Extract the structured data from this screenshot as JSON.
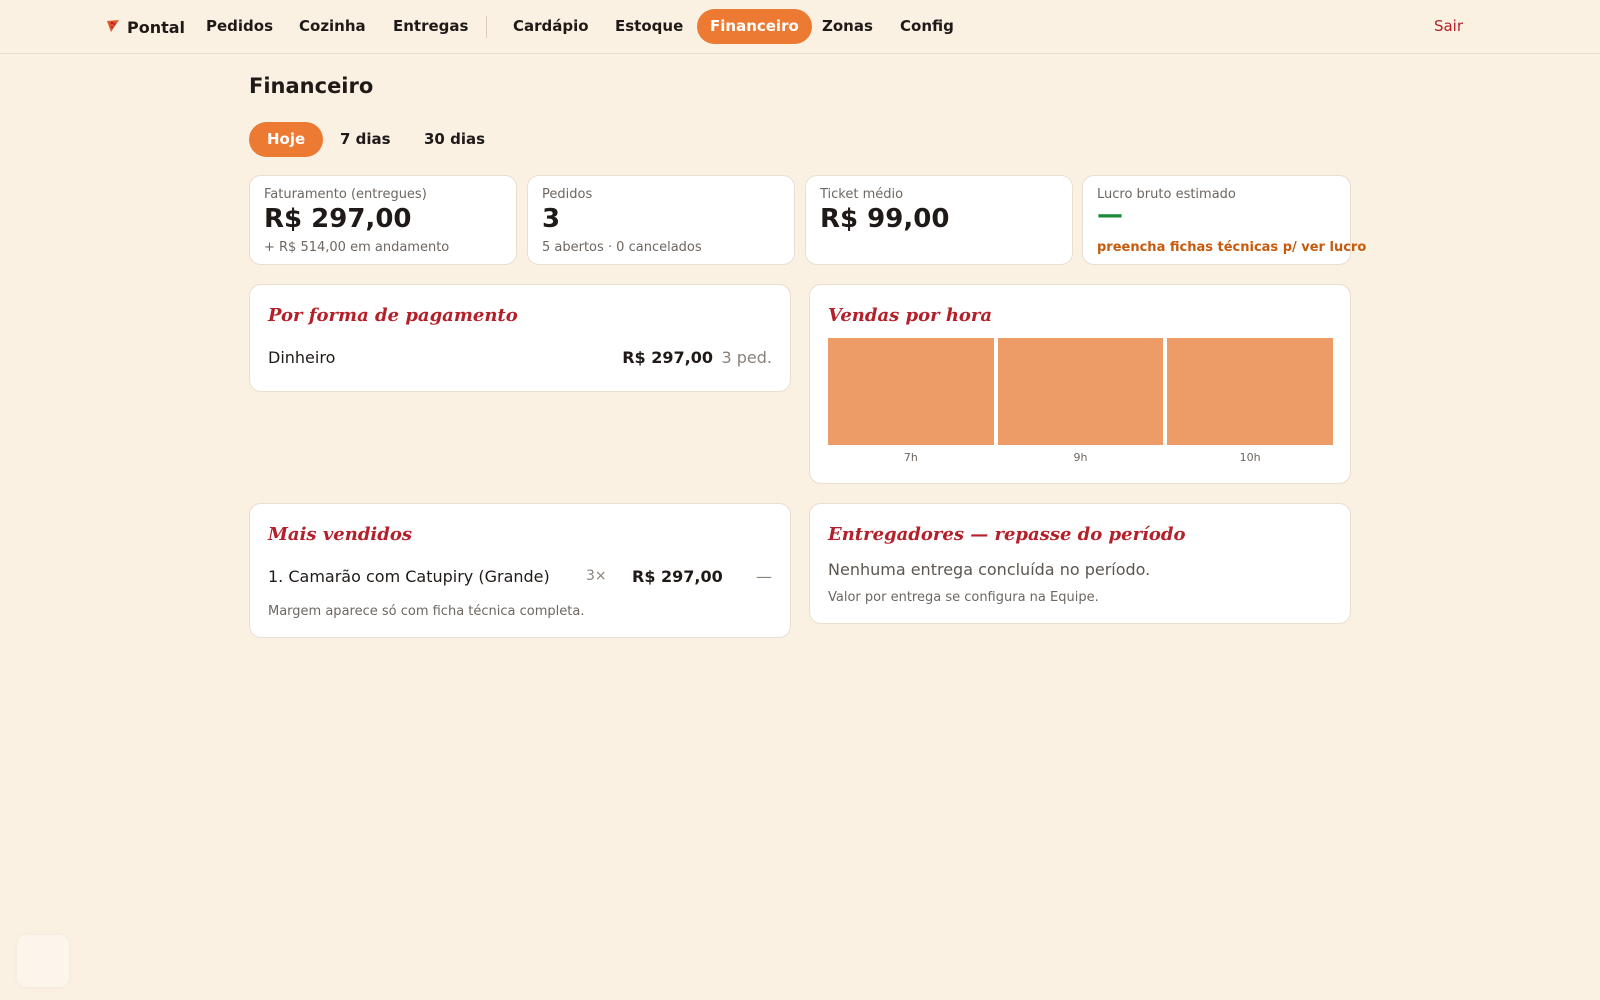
{
  "nav": {
    "brand": "Pontal",
    "items": [
      "Pedidos",
      "Cozinha",
      "Entregas",
      "Cardápio",
      "Estoque",
      "Financeiro",
      "Zonas",
      "Config"
    ],
    "active": "Financeiro",
    "logout": "Sair"
  },
  "page": {
    "title": "Financeiro",
    "periods": [
      "Hoje",
      "7 dias",
      "30 dias"
    ],
    "active_period": "Hoje"
  },
  "stats": {
    "revenue": {
      "label": "Faturamento (entregues)",
      "value": "R$ 297,00",
      "sub": "+ R$ 514,00 em andamento"
    },
    "orders": {
      "label": "Pedidos",
      "value": "3",
      "sub": "5 abertos · 0 cancelados"
    },
    "ticket": {
      "label": "Ticket médio",
      "value": "R$ 99,00"
    },
    "profit": {
      "label": "Lucro bruto estimado",
      "value": "—",
      "warning": "preencha fichas técnicas p/ ver lucro"
    }
  },
  "payment": {
    "title": "Por forma de pagamento",
    "rows": [
      {
        "method": "Dinheiro",
        "amount": "R$ 297,00",
        "count": "3 ped."
      }
    ]
  },
  "hourly": {
    "title": "Vendas por hora"
  },
  "chart_data": {
    "type": "bar",
    "categories": [
      "7h",
      "9h",
      "10h"
    ],
    "values": [
      1,
      1,
      1
    ],
    "ylim": [
      0,
      1
    ]
  },
  "best_sellers": {
    "title": "Mais vendidos",
    "rows": [
      {
        "name": "1. Camarão com Catupiry (Grande)",
        "qty": "3×",
        "amount": "R$ 297,00",
        "margin": "—"
      }
    ],
    "note": "Margem aparece só com ficha técnica completa."
  },
  "couriers": {
    "title": "Entregadores — repasse do período",
    "empty": "Nenhuma entrega concluída no período.",
    "note": "Valor por entrega se configura na Equipe."
  },
  "colors": {
    "background": "#faf1e3",
    "accent": "#ec7a32",
    "bar": "#ee9c67",
    "title_red": "#b3202a",
    "positive": "#1a8a3a",
    "warning": "#c75a0c"
  }
}
